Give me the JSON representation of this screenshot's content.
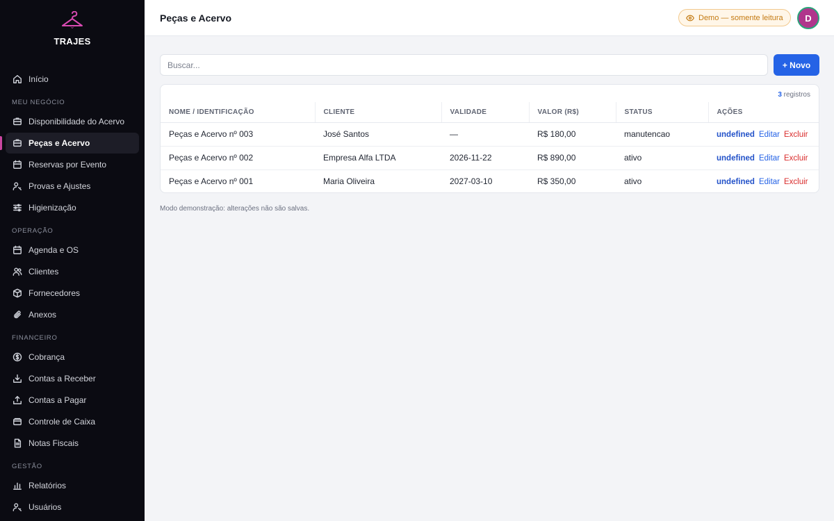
{
  "brand": {
    "name": "TRAJES",
    "logo_icon": "hanger-icon",
    "accent": "#c946a0"
  },
  "sidebar": {
    "home": {
      "label": "Início",
      "icon": "home-icon"
    },
    "sections": [
      {
        "title": "MEU NEGÓCIO",
        "items": [
          {
            "label": "Disponibilidade do Acervo",
            "icon": "box-icon"
          },
          {
            "label": "Peças e Acervo",
            "icon": "box-icon",
            "active": true
          },
          {
            "label": "Reservas por Evento",
            "icon": "calendar-icon"
          },
          {
            "label": "Provas e Ajustes",
            "icon": "user-key-icon"
          },
          {
            "label": "Higienização",
            "icon": "sliders-icon"
          }
        ]
      },
      {
        "title": "OPERAÇÃO",
        "items": [
          {
            "label": "Agenda e OS",
            "icon": "calendar-icon"
          },
          {
            "label": "Clientes",
            "icon": "users-icon"
          },
          {
            "label": "Fornecedores",
            "icon": "package-icon"
          },
          {
            "label": "Anexos",
            "icon": "paperclip-icon"
          }
        ]
      },
      {
        "title": "FINANCEIRO",
        "items": [
          {
            "label": "Cobrança",
            "icon": "dollar-circle-icon"
          },
          {
            "label": "Contas a Receber",
            "icon": "download-icon"
          },
          {
            "label": "Contas a Pagar",
            "icon": "upload-icon"
          },
          {
            "label": "Controle de Caixa",
            "icon": "wallet-icon"
          },
          {
            "label": "Notas Fiscais",
            "icon": "document-icon"
          }
        ]
      },
      {
        "title": "GESTÃO",
        "items": [
          {
            "label": "Relatórios",
            "icon": "bar-chart-icon"
          },
          {
            "label": "Usuários",
            "icon": "user-key-icon"
          }
        ]
      }
    ]
  },
  "header": {
    "title": "Peças e Acervo",
    "demo_badge": "Demo — somente leitura",
    "demo_icon": "eye-icon",
    "avatar_initial": "D"
  },
  "toolbar": {
    "search_placeholder": "Buscar...",
    "new_label": "+ Novo"
  },
  "table": {
    "count": "3",
    "count_suffix": " registros",
    "columns": [
      "NOME / IDENTIFICAÇÃO",
      "CLIENTE",
      "VALIDADE",
      "VALOR (R$)",
      "STATUS",
      "AÇÕES"
    ],
    "rows": [
      {
        "name": "Peças e Acervo nº 003",
        "client": "José Santos",
        "validity": "—",
        "value": "R$ 180,00",
        "status": "manutencao"
      },
      {
        "name": "Peças e Acervo nº 002",
        "client": "Empresa Alfa LTDA",
        "validity": "2026-11-22",
        "value": "R$ 890,00",
        "status": "ativo"
      },
      {
        "name": "Peças e Acervo nº 001",
        "client": "Maria Oliveira",
        "validity": "2027-03-10",
        "value": "R$ 350,00",
        "status": "ativo"
      }
    ],
    "actions": {
      "view": "undefined",
      "edit": "Editar",
      "delete": "Excluir"
    }
  },
  "footnote": "Modo demonstração: alterações não são salvas.",
  "colors": {
    "primary": "#2563e6",
    "danger": "#d92b2b",
    "sidebar_bg": "#0b0b12",
    "warning": "#c47a12"
  }
}
